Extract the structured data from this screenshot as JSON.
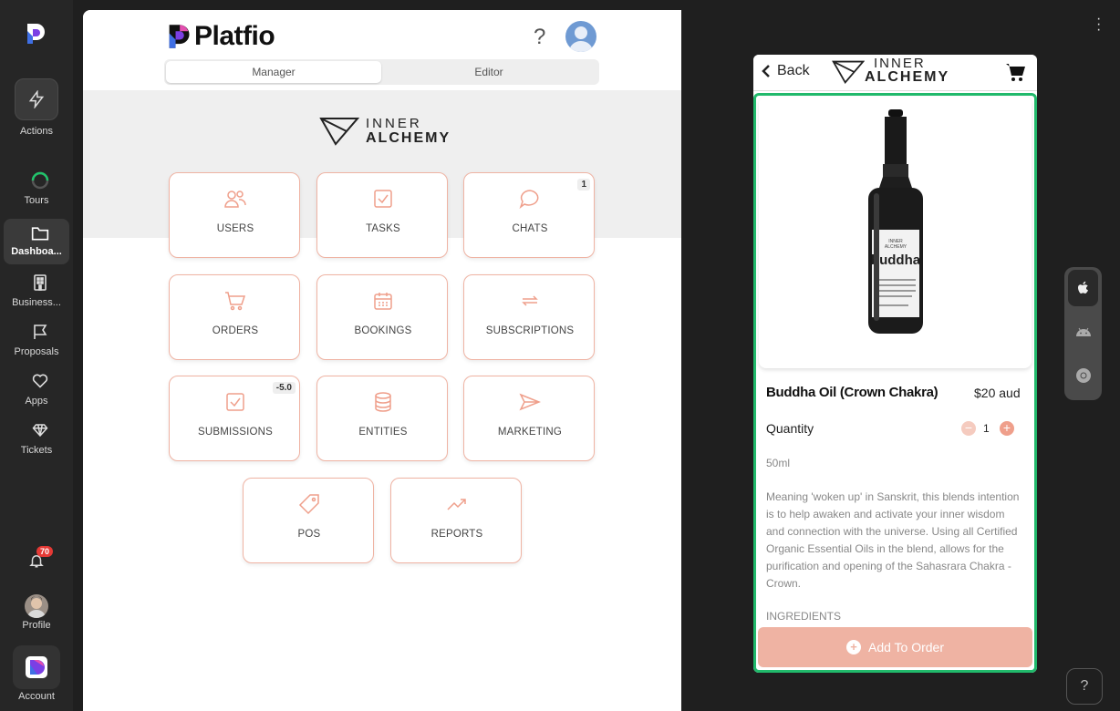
{
  "sidebar": {
    "items": [
      {
        "label": "Actions",
        "icon": "lightning-icon"
      },
      {
        "label": "Tours",
        "icon": "progress-ring-icon"
      },
      {
        "label": "Dashboa...",
        "icon": "folder-icon",
        "active": true
      },
      {
        "label": "Business...",
        "icon": "building-icon"
      },
      {
        "label": "Proposals",
        "icon": "flag-icon"
      },
      {
        "label": "Apps",
        "icon": "heart-icon"
      },
      {
        "label": "Tickets",
        "icon": "diamond-icon"
      }
    ],
    "notifications_count": "70",
    "profile_label": "Profile",
    "account_label": "Account"
  },
  "header": {
    "brand": "Platfio",
    "help": "?",
    "tabs": [
      {
        "label": "Manager",
        "active": true
      },
      {
        "label": "Editor",
        "active": false
      }
    ]
  },
  "business_logo": {
    "line1": "INNER",
    "line2": "ALCHEMY"
  },
  "tiles": [
    {
      "label": "USERS",
      "icon": "users-icon",
      "badge": ""
    },
    {
      "label": "TASKS",
      "icon": "checkbox-icon",
      "badge": ""
    },
    {
      "label": "CHATS",
      "icon": "chat-bubble-icon",
      "badge": "1"
    },
    {
      "label": "ORDERS",
      "icon": "cart-icon",
      "badge": ""
    },
    {
      "label": "BOOKINGS",
      "icon": "calendar-icon",
      "badge": ""
    },
    {
      "label": "SUBSCRIPTIONS",
      "icon": "repeat-icon",
      "badge": ""
    },
    {
      "label": "SUBMISSIONS",
      "icon": "checkbox-icon",
      "badge": "-5.0"
    },
    {
      "label": "ENTITIES",
      "icon": "database-icon",
      "badge": ""
    },
    {
      "label": "MARKETING",
      "icon": "send-icon",
      "badge": ""
    },
    {
      "label": "POS",
      "icon": "tag-icon",
      "badge": ""
    },
    {
      "label": "REPORTS",
      "icon": "trend-up-icon",
      "badge": ""
    }
  ],
  "preview": {
    "back_label": "Back",
    "logo_line1": "INNER",
    "logo_line2": "ALCHEMY",
    "bottle_brand_line1": "INNER",
    "bottle_brand_line2": "ALCHEMY",
    "bottle_name": "buddha",
    "product_title": "Buddha Oil (Crown Chakra)",
    "price": "$20 aud",
    "quantity_label": "Quantity",
    "quantity_value": "1",
    "size": "50ml",
    "description": "Meaning 'woken up' in Sanskrit, this blends intention is to help awaken and activate your inner wisdom and connection with the universe. Using all Certified Organic Essential Oils in the blend, allows for the purification and opening of the Sahasrara Chakra - Crown.",
    "ingredients_label": "INGREDIENTS",
    "add_button_label": "Add To Order"
  },
  "platforms": [
    "apple-icon",
    "android-icon",
    "chrome-icon"
  ],
  "help_button": "?",
  "colors": {
    "accent": "#efb3a3",
    "green_frame": "#21b96b",
    "sidebar_bg": "#262626"
  }
}
